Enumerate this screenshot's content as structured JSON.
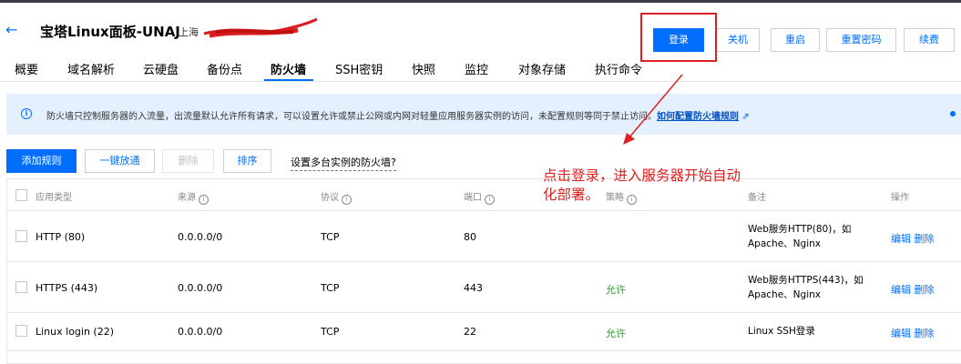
{
  "header": {
    "back_icon": "arrow-left-icon",
    "title": "宝塔Linux面板-UNAJ",
    "region": "上海",
    "buttons": {
      "login": "登录",
      "shutdown": "关机",
      "restart": "重启",
      "reset_password": "重置密码",
      "renew": "续费"
    }
  },
  "tabs": [
    "概要",
    "域名解析",
    "云硬盘",
    "备份点",
    "防火墙",
    "SSH密钥",
    "快照",
    "监控",
    "对象存储",
    "执行命令"
  ],
  "active_tab": "防火墙",
  "notice": {
    "icon": "info-icon",
    "text": "防火墙只控制服务器的入流量，出流量默认允许所有请求，可以设置允许或禁止公网或内网对轻量应用服务器实例的访问，未配置规则等同于禁止访问。",
    "link": "如何配置防火墙规则"
  },
  "actions": {
    "add_rule": "添加规则",
    "one_click_allow": "一键放通",
    "delete": "删除",
    "sort": "排序",
    "multi_instance": "设置多台实例的防火墙?"
  },
  "table": {
    "headers": {
      "app_type": "应用类型",
      "source": "来源",
      "protocol": "协议",
      "port": "端口",
      "policy": "策略",
      "remark": "备注",
      "operation": "操作"
    },
    "rows": [
      {
        "app_type": "HTTP (80)",
        "source": "0.0.0.0/0",
        "protocol": "TCP",
        "port": "80",
        "policy": "",
        "remark_line1": "Web服务HTTP(80)，如",
        "remark_line2": "Apache、Nginx",
        "edit": "编辑",
        "delete": "删除"
      },
      {
        "app_type": "HTTPS (443)",
        "source": "0.0.0.0/0",
        "protocol": "TCP",
        "port": "443",
        "policy": "允许",
        "remark_line1": "Web服务HTTPS(443)，如",
        "remark_line2": "Apache、Nginx",
        "edit": "编辑",
        "delete": "删除"
      },
      {
        "app_type": "Linux login (22)",
        "source": "0.0.0.0/0",
        "protocol": "TCP",
        "port": "22",
        "policy": "允许",
        "remark_line1": "Linux SSH登录",
        "remark_line2": "",
        "edit": "编辑",
        "delete": "删除"
      }
    ]
  },
  "annotation": {
    "line1": "点击登录，进入服务器开始自动",
    "line2": "化部署。",
    "color": "#e02020"
  },
  "colors": {
    "accent": "#006eff",
    "allow": "#29a329",
    "annotation_red": "#e02020",
    "notice_bg": "#e5f0ff"
  }
}
